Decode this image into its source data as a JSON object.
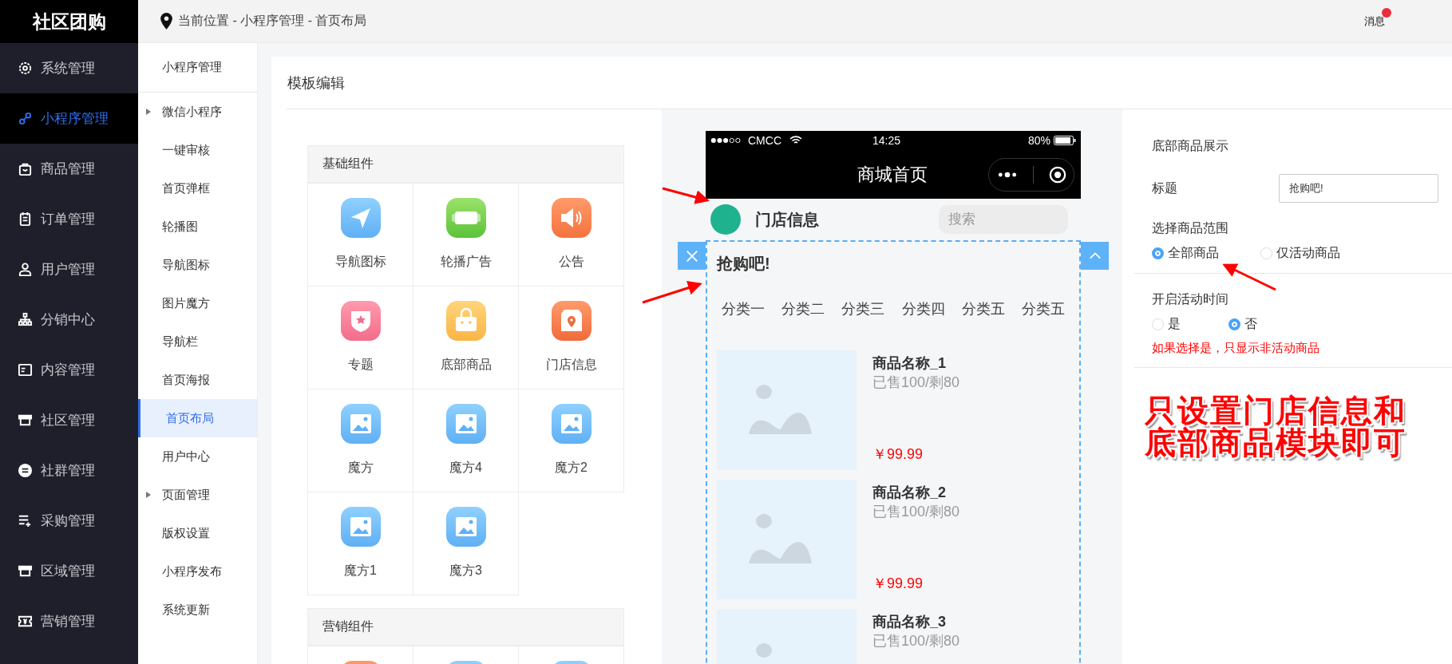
{
  "brand": "社区团购",
  "nav": [
    {
      "label": "系统管理",
      "kind": "gear",
      "selected": false
    },
    {
      "label": "小程序管理",
      "kind": "link",
      "selected": true
    },
    {
      "label": "商品管理",
      "kind": "bag",
      "selected": false
    },
    {
      "label": "订单管理",
      "kind": "clipboard",
      "selected": false
    },
    {
      "label": "用户管理",
      "kind": "user",
      "selected": false
    },
    {
      "label": "分销中心",
      "kind": "org",
      "selected": false
    },
    {
      "label": "内容管理",
      "kind": "news",
      "selected": false
    },
    {
      "label": "社区管理",
      "kind": "store",
      "selected": false
    },
    {
      "label": "社群管理",
      "kind": "minus",
      "selected": false
    },
    {
      "label": "采购管理",
      "kind": "listplus",
      "selected": false
    },
    {
      "label": "区域管理",
      "kind": "store",
      "selected": false
    },
    {
      "label": "营销管理",
      "kind": "ticket",
      "selected": false
    }
  ],
  "breadcrumb": "当前位置 - 小程序管理 - 首页布局",
  "header": {
    "messages": "消息",
    "unread": true
  },
  "subnav": {
    "title": "小程序管理",
    "items": [
      {
        "label": "微信小程序",
        "expandable": true,
        "selected": false
      },
      {
        "label": "一键审核",
        "expandable": false,
        "selected": false
      },
      {
        "label": "首页弹框",
        "expandable": false,
        "selected": false
      },
      {
        "label": "轮播图",
        "expandable": false,
        "selected": false
      },
      {
        "label": "导航图标",
        "expandable": false,
        "selected": false
      },
      {
        "label": "图片魔方",
        "expandable": false,
        "selected": false
      },
      {
        "label": "导航栏",
        "expandable": false,
        "selected": false
      },
      {
        "label": "首页海报",
        "expandable": false,
        "selected": false
      },
      {
        "label": "首页布局",
        "expandable": false,
        "selected": true
      },
      {
        "label": "用户中心",
        "expandable": false,
        "selected": false
      },
      {
        "label": "页面管理",
        "expandable": true,
        "selected": false
      },
      {
        "label": "版权设置",
        "expandable": false,
        "selected": false
      },
      {
        "label": "小程序发布",
        "expandable": false,
        "selected": false
      },
      {
        "label": "系统更新",
        "expandable": false,
        "selected": false
      }
    ]
  },
  "editor": {
    "title": "模板编辑",
    "groups": [
      {
        "title": "基础组件",
        "items": [
          {
            "label": "导航图标",
            "kind": "nav"
          },
          {
            "label": "轮播广告",
            "kind": "banner"
          },
          {
            "label": "公告",
            "kind": "notice"
          },
          {
            "label": "专题",
            "kind": "topic"
          },
          {
            "label": "底部商品",
            "kind": "goods"
          },
          {
            "label": "门店信息",
            "kind": "shop"
          },
          {
            "label": "魔方",
            "kind": "image"
          },
          {
            "label": "魔方4",
            "kind": "image"
          },
          {
            "label": "魔方2",
            "kind": "image"
          },
          {
            "label": "魔方1",
            "kind": "image"
          },
          {
            "label": "魔方3",
            "kind": "image"
          }
        ]
      },
      {
        "title": "营销组件",
        "items": [
          {
            "kind": "notice"
          },
          {
            "kind": "image"
          },
          {
            "kind": "image"
          }
        ]
      }
    ]
  },
  "phone": {
    "carrier": "CMCC",
    "time": "14:25",
    "battery": "80%",
    "page_title": "商城首页",
    "store": "门店信息",
    "search_placeholder": "搜索",
    "block": {
      "title": "抢购吧!",
      "categories": [
        "分类一",
        "分类二",
        "分类三",
        "分类四",
        "分类五",
        "分类五"
      ],
      "products": [
        {
          "name": "商品名称_1",
          "stock": "已售100/剩80",
          "price": "￥99.99"
        },
        {
          "name": "商品名称_2",
          "stock": "已售100/剩80",
          "price": "￥99.99"
        },
        {
          "name": "商品名称_3",
          "stock": "已售100/剩80"
        }
      ]
    }
  },
  "settings": {
    "heading": "底部商品展示",
    "title_label": "标题",
    "title_value": "抢购吧!",
    "range_label": "选择商品范围",
    "range_options": [
      {
        "label": "全部商品",
        "selected": true
      },
      {
        "label": "仅活动商品",
        "selected": false
      }
    ],
    "time_label": "开启活动时间",
    "time_options": [
      {
        "label": "是",
        "selected": false
      },
      {
        "label": "否",
        "selected": true
      }
    ],
    "hint": "如果选择是，只显示非活动商品"
  },
  "annotation": {
    "lines": [
      "只设置门店信息和",
      "底部商品模块即可"
    ]
  }
}
